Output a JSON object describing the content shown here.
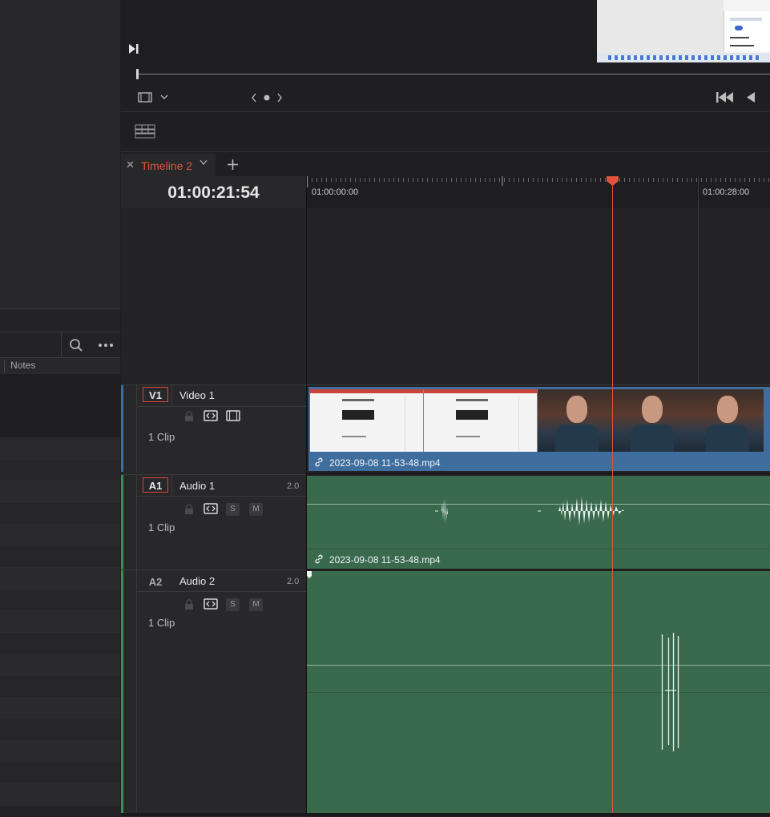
{
  "left_panel": {
    "column_header": "Notes",
    "rows_count": 18
  },
  "viewer": {
    "preview_text": [
      "...",
      "...",
      "..."
    ]
  },
  "timeline": {
    "tab_title": "Timeline 2",
    "timecode": "01:00:21:54",
    "ruler_labels": [
      "01:00:00:00",
      "01:00:28:00"
    ],
    "tracks": [
      {
        "id": "V1",
        "name": "Video 1",
        "clips": "1 Clip",
        "channels": "",
        "clip_name": "2023-09-08 11-53-48.mp4"
      },
      {
        "id": "A1",
        "name": "Audio 1",
        "clips": "1 Clip",
        "channels": "2.0",
        "clip_name": "2023-09-08 11-53-48.mp4"
      },
      {
        "id": "A2",
        "name": "Audio 2",
        "clips": "1 Clip",
        "channels": "2.0",
        "clip_name": ""
      }
    ],
    "solo_label": "S",
    "mute_label": "M"
  },
  "colors": {
    "accent": "#e0533e",
    "video_clip": "#3f6e9e",
    "audio_clip": "#3a6a4e"
  }
}
